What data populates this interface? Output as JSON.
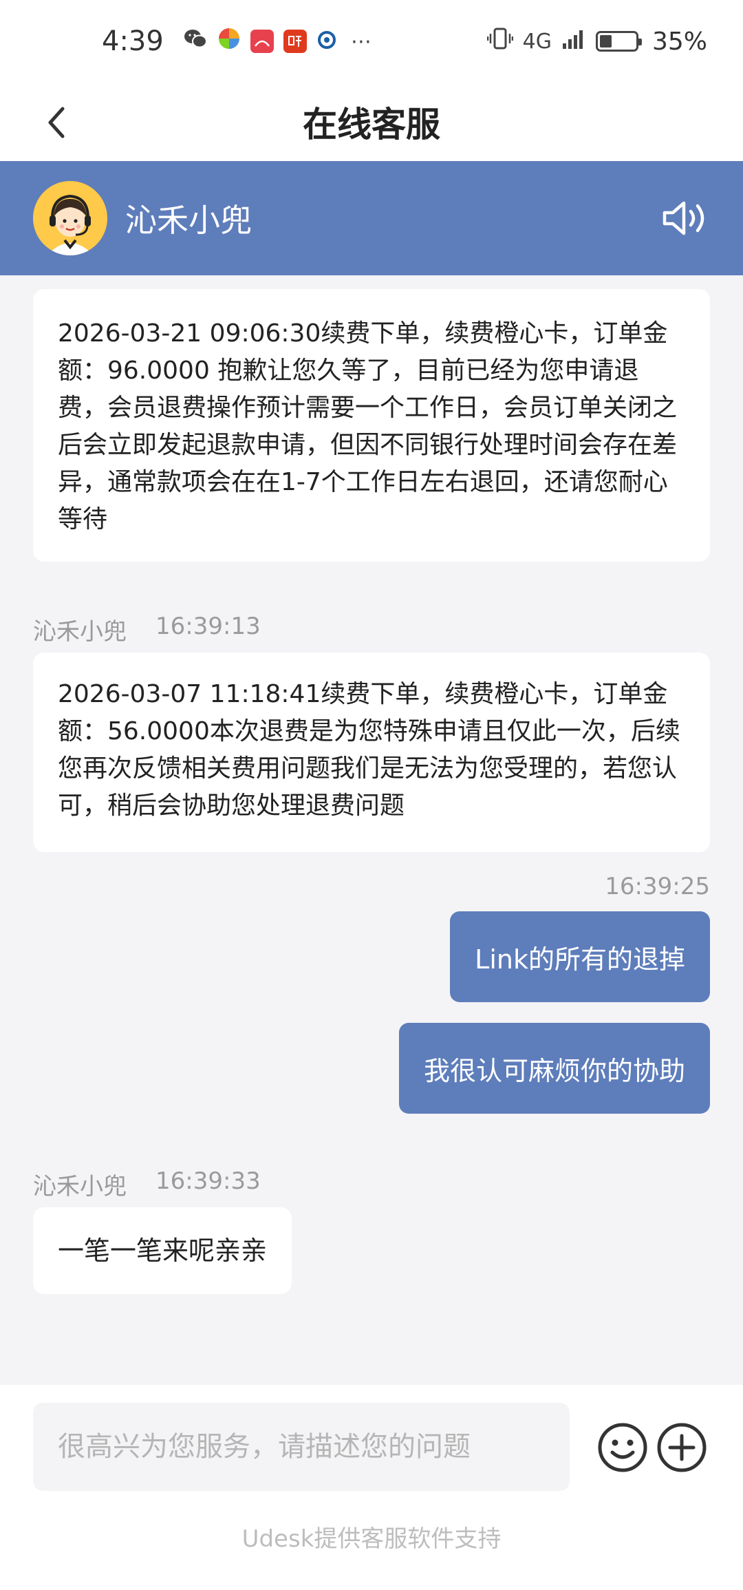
{
  "status_bar": {
    "time": "4:39",
    "network": "4G",
    "battery_percent_text": "35%",
    "battery_level": 0.35,
    "notification_icons": [
      "wechat-icon",
      "pinwheel-icon",
      "huawei-icon",
      "ting-icon",
      "app-icon"
    ]
  },
  "header": {
    "title": "在线客服"
  },
  "agent": {
    "name": "沁禾小兜"
  },
  "messages": [
    {
      "direction": "incoming",
      "text": "2026-03-21 09:06:30续费下单，续费橙心卡，订单金额：96.0000 抱歉让您久等了，目前已经为您申请退费，会员退费操作预计需要一个工作日，会员订单关闭之后会立即发起退款申请，但因不同银行处理时间会存在差异，通常款项会在在1-7个工作日左右退回，还请您耐心等待"
    },
    {
      "direction": "incoming",
      "sender": "沁禾小兜",
      "time": "16:39:13",
      "text": "2026-03-07 11:18:41续费下单，续费橙心卡，订单金额：56.0000本次退费是为您特殊申请且仅此一次，后续您再次反馈相关费用问题我们是无法为您受理的，若您认可，稍后会协助您处理退费问题"
    },
    {
      "direction": "outgoing",
      "time": "16:39:25",
      "text": "Link的所有的退掉"
    },
    {
      "direction": "outgoing",
      "text": "我很认可麻烦你的协助"
    },
    {
      "direction": "incoming",
      "sender": "沁禾小兜",
      "time": "16:39:33",
      "text": "一笔一笔来呢亲亲"
    }
  ],
  "input": {
    "placeholder": "很高兴为您服务，请描述您的问题",
    "value": ""
  },
  "footer": {
    "powered_by": "Udesk提供客服软件支持"
  },
  "colors": {
    "accent": "#5e7dbb",
    "background": "#f4f4f6",
    "bubble_incoming": "#ffffff",
    "avatar_bg": "#ffc94a"
  }
}
